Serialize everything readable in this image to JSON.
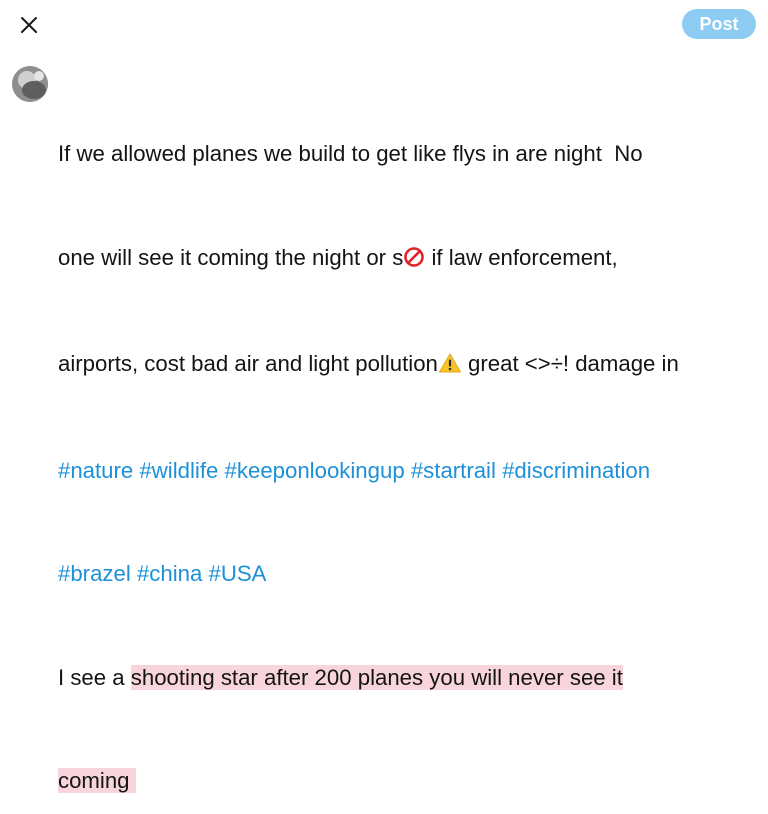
{
  "toolbar": {
    "close_icon": "close-icon",
    "post_label": "Post",
    "post_color": "#8ccbf2"
  },
  "composer": {
    "avatar": "avatar",
    "line1": "If we allowed planes we build to get like flys in are night  No",
    "line2_a": "one will see it coming the night or s",
    "line2_b": " if law enforcement,",
    "line3_a": "airports, cost bad air and light pollution",
    "line3_b": " great <>÷! damage in",
    "hashtags_row1": [
      "#nature",
      "#wildlife",
      "#keeponlookingup",
      "#startrail",
      "#discrimination"
    ],
    "hashtags_row2": [
      "#brazel",
      "#china",
      "#USA"
    ],
    "line6_a": "I see a ",
    "line6_highlight": "shooting star after 200 planes you will never see it",
    "line7_highlight": "coming ",
    "hashtag_color": "#1d91d8",
    "highlight_color": "#f8d5dd",
    "emoji_1": "prohibited-icon",
    "emoji_2": "warning-icon"
  }
}
